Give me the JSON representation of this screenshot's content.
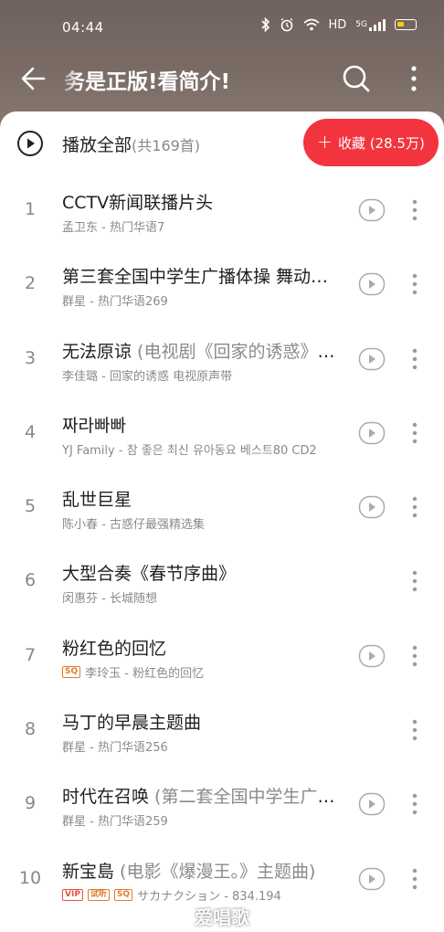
{
  "status_bar": {
    "time": "04:44",
    "network": "HD",
    "signal_type": "5G",
    "icons": [
      "bluetooth-icon",
      "alarm-icon",
      "wifi-icon",
      "signal-icon",
      "battery-icon"
    ]
  },
  "topbar": {
    "title": "务是正版!看简介!"
  },
  "play_all": {
    "label": "播放全部",
    "count": "(共169首)"
  },
  "collect_button": {
    "label": "收藏 (28.5万)",
    "color": "#f2343f"
  },
  "songs": [
    {
      "index": "1",
      "title": "CCTV新闻联播片头",
      "title_suffix": "",
      "subtitle": "孟卫东 - 热门华语7",
      "tags": [],
      "has_video": true
    },
    {
      "index": "2",
      "title": "第三套全国中学生广播体操 舞动青春",
      "title_suffix": "",
      "subtitle": "群星 - 热门华语269",
      "tags": [],
      "has_video": true
    },
    {
      "index": "3",
      "title": "无法原谅",
      "title_suffix": " (电视剧《回家的诱惑》主题曲)",
      "subtitle": "李佳璐 - 回家的诱惑 电视原声带",
      "tags": [],
      "has_video": true
    },
    {
      "index": "4",
      "title": "짜라빠빠",
      "title_suffix": "",
      "subtitle": "YJ Family - 참 좋은 최신 유아동요 베스트80 CD2",
      "tags": [],
      "has_video": true
    },
    {
      "index": "5",
      "title": "乱世巨星",
      "title_suffix": "",
      "subtitle": "陈小春 - 古惑仔最强精选集",
      "tags": [],
      "has_video": true
    },
    {
      "index": "6",
      "title": "大型合奏《春节序曲》",
      "title_suffix": "",
      "subtitle": "闵惠芬 - 长城随想",
      "tags": [],
      "has_video": false
    },
    {
      "index": "7",
      "title": "粉红色的回忆",
      "title_suffix": "",
      "subtitle": "李玲玉 - 粉红色的回忆",
      "tags": [
        "SQ"
      ],
      "has_video": true
    },
    {
      "index": "8",
      "title": "马丁的早晨主题曲",
      "title_suffix": "",
      "subtitle": "群星 - 热门华语256",
      "tags": [],
      "has_video": false
    },
    {
      "index": "9",
      "title": "时代在召唤",
      "title_suffix": " (第二套全国中学生广播体操)",
      "subtitle": "群星 - 热门华语259",
      "tags": [],
      "has_video": true
    },
    {
      "index": "10",
      "title": "新宝島",
      "title_suffix": " (电影《爆漫王。》主题曲)",
      "subtitle": "サカナクション - 834.194",
      "tags": [
        "VIP",
        "试听",
        "SQ"
      ],
      "has_video": true
    }
  ],
  "watermark": "爱唱歌",
  "colors": {
    "header_bg": "#7a6b65",
    "accent_red": "#f2343f",
    "tag_orange": "#e07a2f"
  }
}
